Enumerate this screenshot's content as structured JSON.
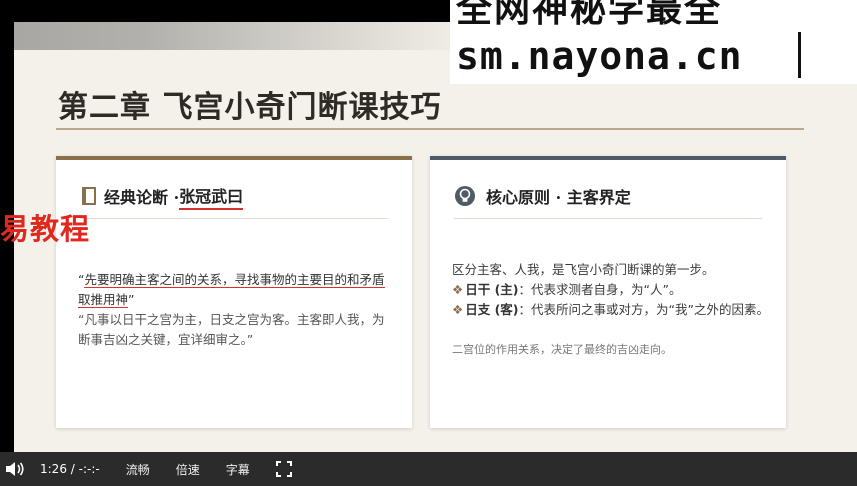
{
  "overlay": {
    "line1": "全网神秘学最全",
    "line2": "sm.nayona.cn"
  },
  "watermark_left": "易教程",
  "slide": {
    "title": "第二章 飞宫小奇门断课技巧",
    "left_card": {
      "heading_prefix": "经典论断 · ",
      "heading_highlight": "张冠武曰",
      "quote1_open": "“",
      "quote1_underlined": "先要明确主客之间的关系，寻找事物的主要目的和矛盾取推用神",
      "quote1_close": "”",
      "quote2": "“凡事以日干之宫为主，日支之宫为客。主客即人我，为断事吉凶之关键，宜详细审之。”"
    },
    "right_card": {
      "heading": "核心原则 · 主客界定",
      "intro": "区分主客、人我，是飞宫小奇门断课的第一步。",
      "bullet_mark": "❖",
      "bullet1_key": "日干 (主)",
      "bullet1_text": "：代表求测者自身，为“人”。",
      "bullet2_key": "日支 (客)",
      "bullet2_text": "：代表所问之事或对方，为“我”之外的因素。",
      "footer": "二宫位的作用关系，决定了最终的吉凶走向。"
    }
  },
  "player": {
    "time": "1:26 / -:-:-",
    "smooth_label": "流畅",
    "speed_label": "倍速",
    "subtitle_label": "字幕"
  },
  "colors": {
    "left_accent": "#8a6f4d",
    "right_accent": "#4f5b66",
    "red": "#d6322e"
  }
}
